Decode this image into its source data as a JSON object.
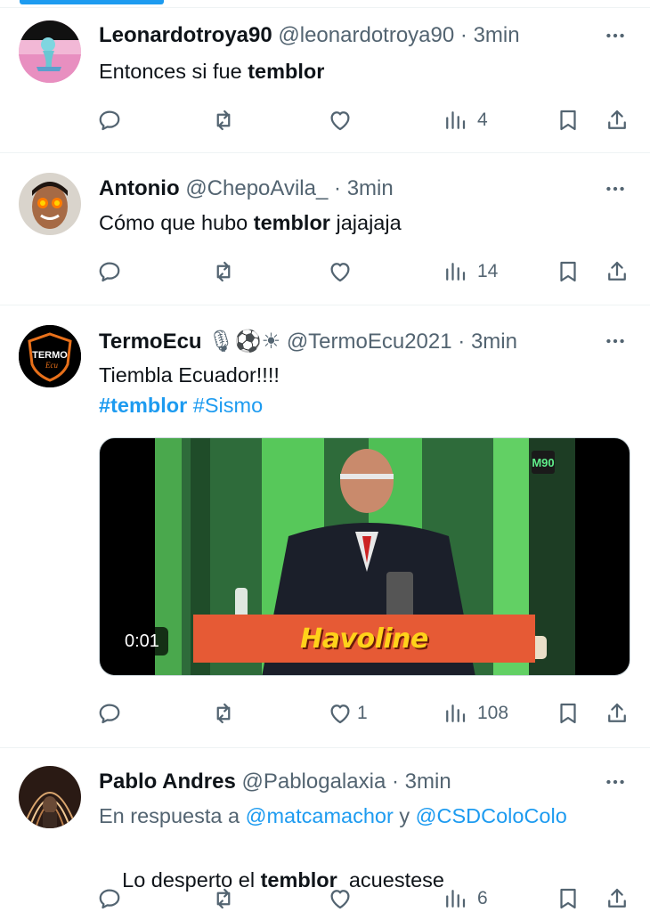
{
  "colors": {
    "accent": "#1d9bf0",
    "secondary_text": "#536471",
    "primary_text": "#0f1419",
    "divider": "#eff3f4"
  },
  "tweets": [
    {
      "name": "Leonardotroya90",
      "handle": "@leonardotroya90",
      "separator": "·",
      "time": "3min",
      "text_pre": "Entonces si fue ",
      "text_bold": "temblor",
      "text_post": "",
      "views": "4",
      "icons": [
        "reply-icon",
        "retweet-icon",
        "like-icon",
        "views-icon",
        "bookmark-icon",
        "share-icon"
      ]
    },
    {
      "name": "Antonio",
      "handle": "@ChepoAvila_",
      "separator": "·",
      "time": "3min",
      "text_pre": "Cómo que hubo ",
      "text_bold": "temblor",
      "text_post": " jajajaja",
      "views": "14"
    },
    {
      "name": "TermoEcu",
      "name_emojis": "🎙⚽☀",
      "handle": "@TermoEcu2021",
      "separator": "·",
      "time": "3min",
      "text": "Tiembla Ecuador!!!!",
      "hashtag1": "#temblor",
      "hashtag2": "#Sismo",
      "avatar_text": "TERMO",
      "avatar_sub": "Ecu",
      "video": {
        "duration": "0:01",
        "banner": "Havoline",
        "channel": "M90"
      },
      "likes": "1",
      "views": "108"
    },
    {
      "name": "Pablo Andres",
      "handle": "@Pablogalaxia",
      "separator": "·",
      "time": "3min",
      "reply_prefix": "En respuesta a ",
      "reply_user1": "@matcamachor",
      "reply_joiner": " y ",
      "reply_user2": "@CSDColoColo",
      "text_pre": "Lo desperto el ",
      "text_bold": "temblor",
      "text_post": "  acuestese",
      "views": "6"
    }
  ]
}
